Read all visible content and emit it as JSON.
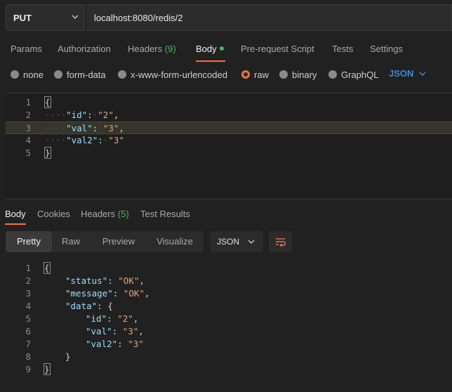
{
  "request": {
    "method": "PUT",
    "url": "localhost:8080/redis/2"
  },
  "request_tabs": [
    {
      "label": "Params"
    },
    {
      "label": "Authorization"
    },
    {
      "label": "Headers",
      "count": "(9)"
    },
    {
      "label": "Body"
    },
    {
      "label": "Pre-request Script"
    },
    {
      "label": "Tests"
    },
    {
      "label": "Settings"
    }
  ],
  "body_types": [
    {
      "label": "none"
    },
    {
      "label": "form-data"
    },
    {
      "label": "x-www-form-urlencoded"
    },
    {
      "label": "raw"
    },
    {
      "label": "binary"
    },
    {
      "label": "GraphQL"
    }
  ],
  "body_format": "JSON",
  "request_body": {
    "line_numbers": [
      "1",
      "2",
      "3",
      "4",
      "5"
    ],
    "open": "{",
    "close": "}",
    "fields": [
      {
        "key": "\"id\"",
        "value": "\"2\"",
        "sep": ","
      },
      {
        "key": "\"val\"",
        "value": "\"3\"",
        "sep": ","
      },
      {
        "key": "\"val2\"",
        "value": "\"3\"",
        "sep": ""
      }
    ]
  },
  "response_tabs": [
    {
      "label": "Body"
    },
    {
      "label": "Cookies"
    },
    {
      "label": "Headers",
      "count": "(5)"
    },
    {
      "label": "Test Results"
    }
  ],
  "view_modes": [
    {
      "label": "Pretty"
    },
    {
      "label": "Raw"
    },
    {
      "label": "Preview"
    },
    {
      "label": "Visualize"
    }
  ],
  "response_format": "JSON",
  "response_body": {
    "line_numbers": [
      "1",
      "2",
      "3",
      "4",
      "5",
      "6",
      "7",
      "8",
      "9"
    ],
    "open": "{",
    "close": "}",
    "status_key": "\"status\"",
    "status_value": "\"OK\"",
    "message_key": "\"message\"",
    "message_value": "\"OK\"",
    "data_key": "\"data\"",
    "data_open": "{",
    "data_close": "}",
    "data_fields": [
      {
        "key": "\"id\"",
        "value": "\"2\"",
        "sep": ","
      },
      {
        "key": "\"val\"",
        "value": "\"3\"",
        "sep": ","
      },
      {
        "key": "\"val2\"",
        "value": "\"3\"",
        "sep": ""
      }
    ]
  },
  "colors": {
    "accent": "#ff6c37",
    "green": "#49b85b",
    "link_blue": "#3b8bd6"
  },
  "icons": [
    "chevron-down-icon",
    "wrap-lines-icon"
  ]
}
